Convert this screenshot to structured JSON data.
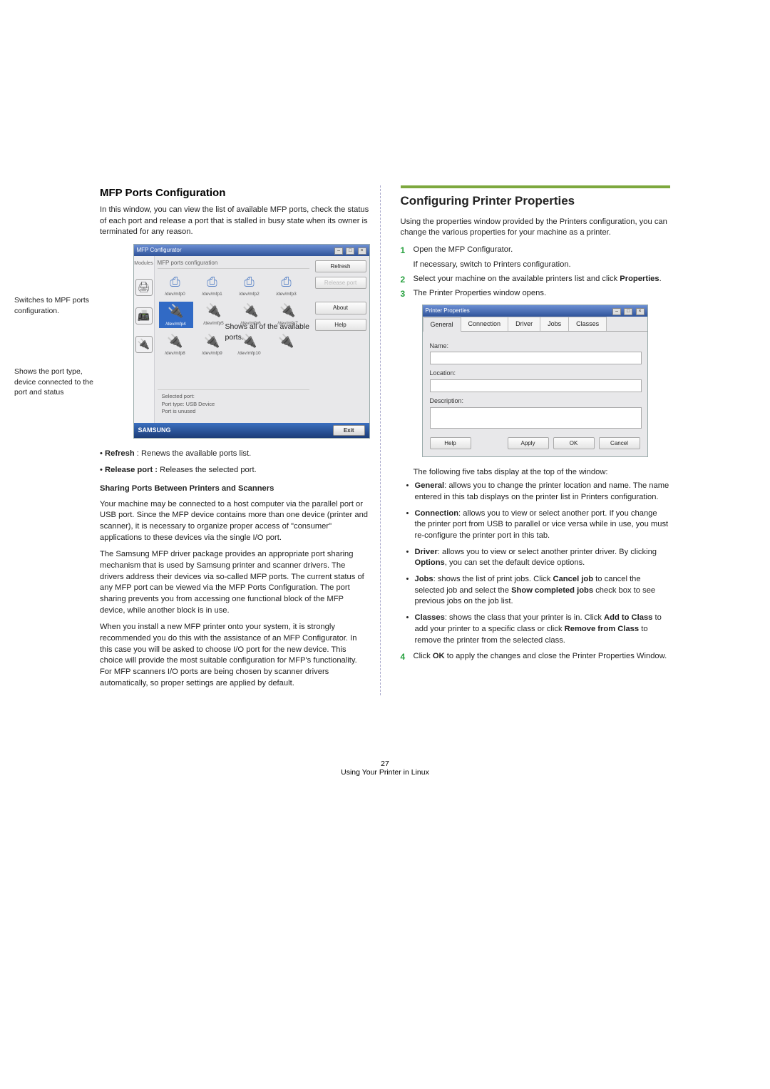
{
  "left": {
    "heading": "MFP Ports Configuration",
    "intro": "In this window, you can view the list of available MFP ports, check the status of each port and release a port that is stalled in busy state when its owner is terminated for any reason.",
    "callout_switch": "Switches to MPF ports configuration.",
    "callout_shows_all": "Shows all of the available ports.",
    "callout_status": "Shows the port type, device connected to the port and status",
    "bullet_refresh_term": "Refresh",
    "bullet_refresh_desc": " : Renews the available ports list.",
    "bullet_release_term": "Release port :",
    "bullet_release_desc": " Releases the selected port.",
    "subhead": "Sharing Ports Between Printers and Scanners",
    "p1": "Your machine may be connected to a host computer via the parallel port or USB port. Since the MFP device contains more than one device (printer and scanner), it is necessary to organize proper access of \"consumer\" applications to these devices via the single I/O port.",
    "p2": "The Samsung MFP driver package provides an appropriate port sharing mechanism that is used by Samsung printer and scanner drivers. The drivers address their devices via so-called MFP ports. The current status of any MFP port can be viewed via the MFP Ports Configuration. The port sharing prevents you from accessing one functional block of the MFP device, while another block is in use.",
    "p3": "When you install a new MFP printer onto your system, it is strongly recommended you do this with the assistance of an MFP Configurator. In this case you will be asked to choose I/O port for the new device. This choice will provide the most suitable configuration for MFP's functionality. For MFP scanners I/O ports are being chosen by scanner drivers automatically, so proper settings are applied by default."
  },
  "mfp_window": {
    "title": "MFP Configurator",
    "modules_label": "Modules",
    "ports_head": "MFP ports configuration",
    "btn_refresh": "Refresh",
    "btn_release": "Release port",
    "btn_about": "About",
    "btn_help": "Help",
    "sel_label": "Selected port:",
    "sel_type": "Port type: USB Device",
    "sel_status": "Port is unused",
    "brand": "SAMSUNG",
    "exit": "Exit",
    "ports": [
      {
        "name": "/dev/mfp0",
        "kind": "par"
      },
      {
        "name": "/dev/mfp1",
        "kind": "par"
      },
      {
        "name": "/dev/mfp2",
        "kind": "par"
      },
      {
        "name": "/dev/mfp3",
        "kind": "par"
      },
      {
        "name": "/dev/mfp4",
        "kind": "usb",
        "sel": true
      },
      {
        "name": "/dev/mfp5",
        "kind": "usb"
      },
      {
        "name": "/dev/mfp6",
        "kind": "usb"
      },
      {
        "name": "/dev/mfp7",
        "kind": "usb"
      },
      {
        "name": "/dev/mfp8",
        "kind": "usb"
      },
      {
        "name": "/dev/mfp9",
        "kind": "usb"
      },
      {
        "name": "/dev/mfp10",
        "kind": "usb"
      },
      {
        "name": "",
        "kind": "usb"
      }
    ]
  },
  "right": {
    "heading": "Configuring Printer Properties",
    "intro": "Using the properties window provided by the Printers configuration, you can change the various properties for your machine as a printer.",
    "step1": "Open the MFP Configurator.",
    "step1_sub": "If necessary, switch to Printers configuration.",
    "step2_a": "Select your machine on the available printers list and click ",
    "step2_b": "Properties",
    "step2_c": ".",
    "step3": "The Printer Properties window opens.",
    "tabs_intro": "The following five tabs display at the top of the window:",
    "b_general_t": "General",
    "b_general_d": ": allows you to change the printer location and name. The name entered in this tab displays on the printer list in Printers configuration.",
    "b_conn_t": "Connection",
    "b_conn_d": ": allows you to view or select another port. If you change the printer port from USB to parallel or vice versa while in use, you must re-configure the printer port in this tab.",
    "b_driver_t": "Driver",
    "b_driver_pre": ": allows you to view or select another printer driver. By clicking ",
    "b_driver_opt": "Options",
    "b_driver_post": ", you can set the default device options.",
    "b_jobs_t": "Jobs",
    "b_jobs_pre": ": shows the list of print jobs. Click ",
    "b_jobs_cancel": "Cancel job",
    "b_jobs_mid": " to cancel the selected job and select the ",
    "b_jobs_show": "Show completed jobs",
    "b_jobs_post": " check box to see previous jobs on the job list.",
    "b_classes_t": "Classes",
    "b_classes_pre": ": shows the class that your printer is in. Click ",
    "b_classes_add": "Add to Class",
    "b_classes_mid": " to add your printer to a specific class or click ",
    "b_classes_rem": "Remove from Class",
    "b_classes_post": " to remove the printer from the selected class.",
    "step4_a": "Click ",
    "step4_b": "OK",
    "step4_c": " to apply the changes and close the Printer Properties Window."
  },
  "pp_window": {
    "title": "Printer Properties",
    "tabs": [
      "General",
      "Connection",
      "Driver",
      "Jobs",
      "Classes"
    ],
    "lbl_name": "Name:",
    "lbl_location": "Location:",
    "lbl_desc": "Description:",
    "btn_help": "Help",
    "btn_apply": "Apply",
    "btn_ok": "OK",
    "btn_cancel": "Cancel"
  },
  "footer": {
    "page": "27",
    "caption": "Using Your Printer in Linux"
  }
}
